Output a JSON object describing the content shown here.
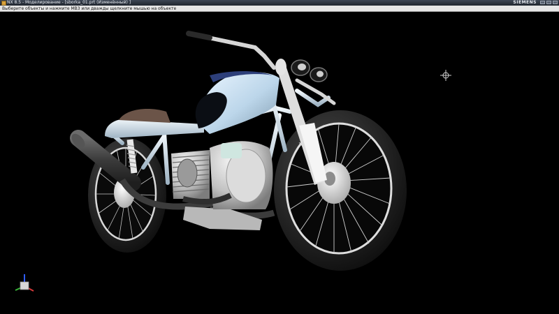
{
  "window": {
    "title": "NX 8.5 - Моделирование - [sborka_01.prt (Изменённый) ]",
    "brand": "SIEMENS"
  },
  "cue_line": {
    "text": "Выберите объекты и нажмите МВ3 или дважды щелкните мышью на объекте"
  },
  "viewport": {
    "background": "#000000",
    "model_name": "motorcycle-model"
  }
}
